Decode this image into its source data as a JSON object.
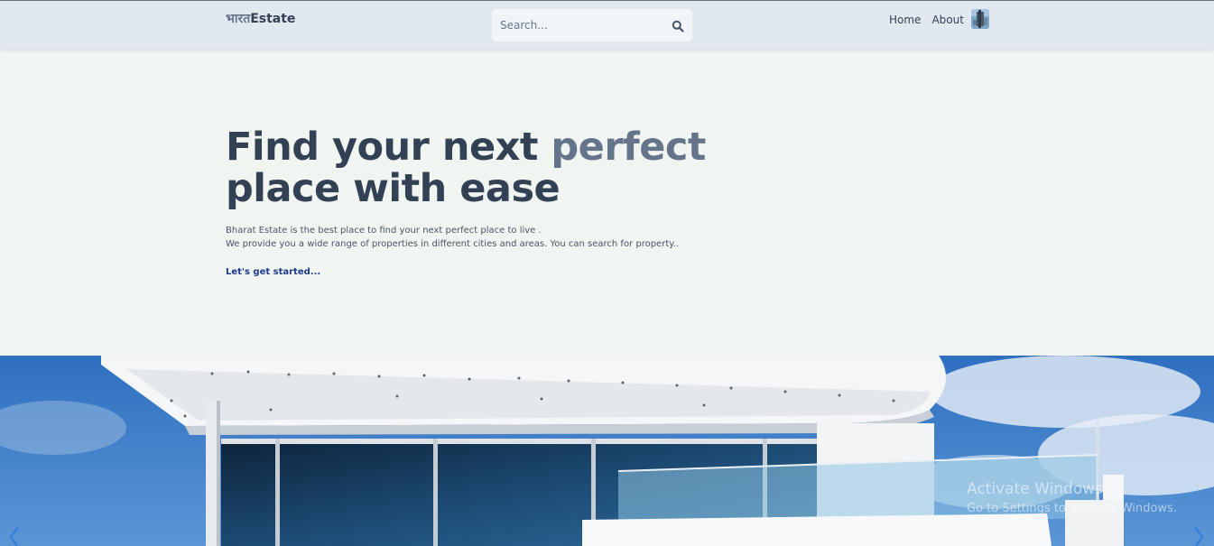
{
  "header": {
    "logo_part1": "भारत",
    "logo_part2": "Estate",
    "search_placeholder": "Search...",
    "nav": [
      {
        "label": "Home"
      },
      {
        "label": "About"
      }
    ]
  },
  "hero": {
    "title_line1_start": "Find your next ",
    "title_accent": "perfect",
    "title_line2": "place with ease",
    "description_line1": "Bharat Estate is the best place to find your next perfect place to live .",
    "description_line2": "We provide you a wide range of properties in different cities and areas. You can search for property..",
    "cta": "Let's get started..."
  },
  "watermark": {
    "line1": "Activate Windows",
    "line2": "Go to Settings to activate Windows."
  },
  "colors": {
    "header_bg": "#e2e8f0",
    "page_bg": "#f1f5f1",
    "text_dark": "#334155",
    "text_accent": "#64748b",
    "link": "#1e3a8a"
  }
}
